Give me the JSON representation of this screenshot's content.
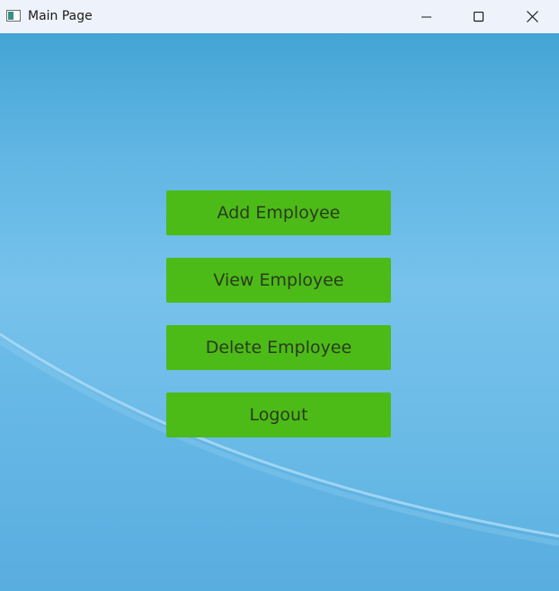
{
  "window": {
    "title": "Main Page",
    "icons": {
      "app": "app-window-icon",
      "minimize": "minimize-icon",
      "maximize": "maximize-icon",
      "close": "close-icon"
    }
  },
  "menu": {
    "add_label": "Add Employee",
    "view_label": "View Employee",
    "delete_label": "Delete Employee",
    "logout_label": "Logout"
  },
  "colors": {
    "button_bg": "#4cbb17",
    "button_text": "#2b3a1f",
    "background_blue": "#6cbbe7",
    "titlebar_bg": "#eef2fa"
  }
}
